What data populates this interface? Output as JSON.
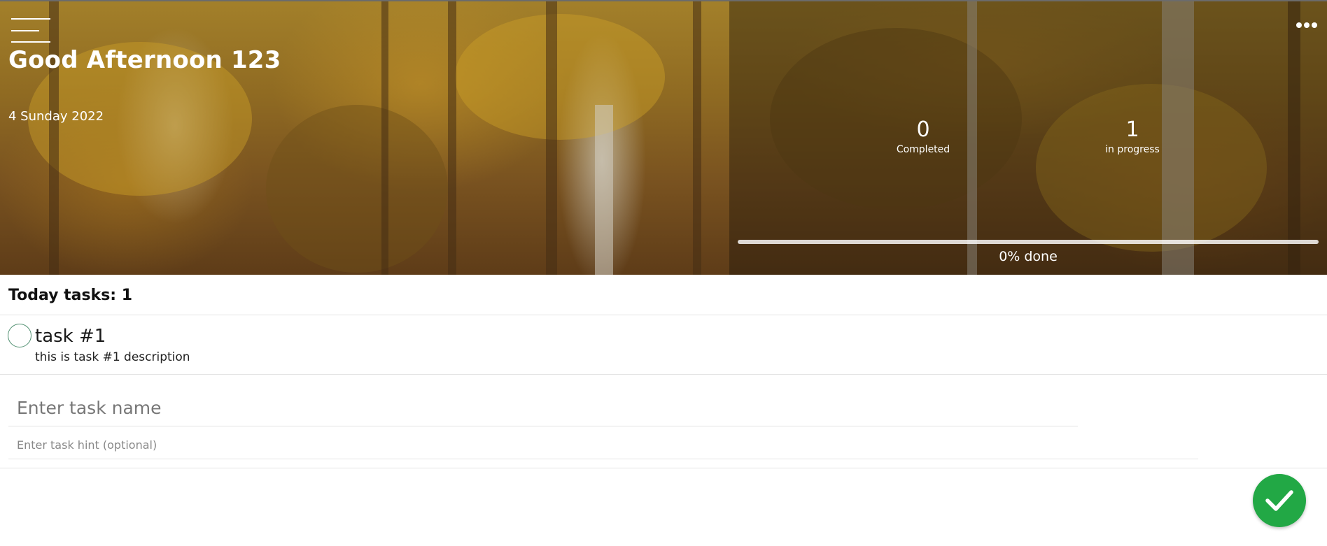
{
  "header": {
    "greeting": "Good Afternoon 123",
    "date": "4 Sunday 2022",
    "menu_icon": "hamburger-menu-icon",
    "more_icon": "more-horizontal-icon"
  },
  "stats": {
    "completed": {
      "value": "0",
      "label": "Completed"
    },
    "in_progress": {
      "value": "1",
      "label": "in progress"
    }
  },
  "progress": {
    "percent": 0,
    "label": "0% done"
  },
  "tasks": {
    "heading": "Today tasks: 1",
    "items": [
      {
        "title": "task #1",
        "description": "this is task #1 description",
        "completed": false
      }
    ]
  },
  "form": {
    "name_placeholder": "Enter task name",
    "hint_placeholder": "Enter task hint (optional)",
    "submit_icon": "checkmark-icon"
  },
  "colors": {
    "accent": "#22a845",
    "checkbox_border": "#4f8f70"
  }
}
